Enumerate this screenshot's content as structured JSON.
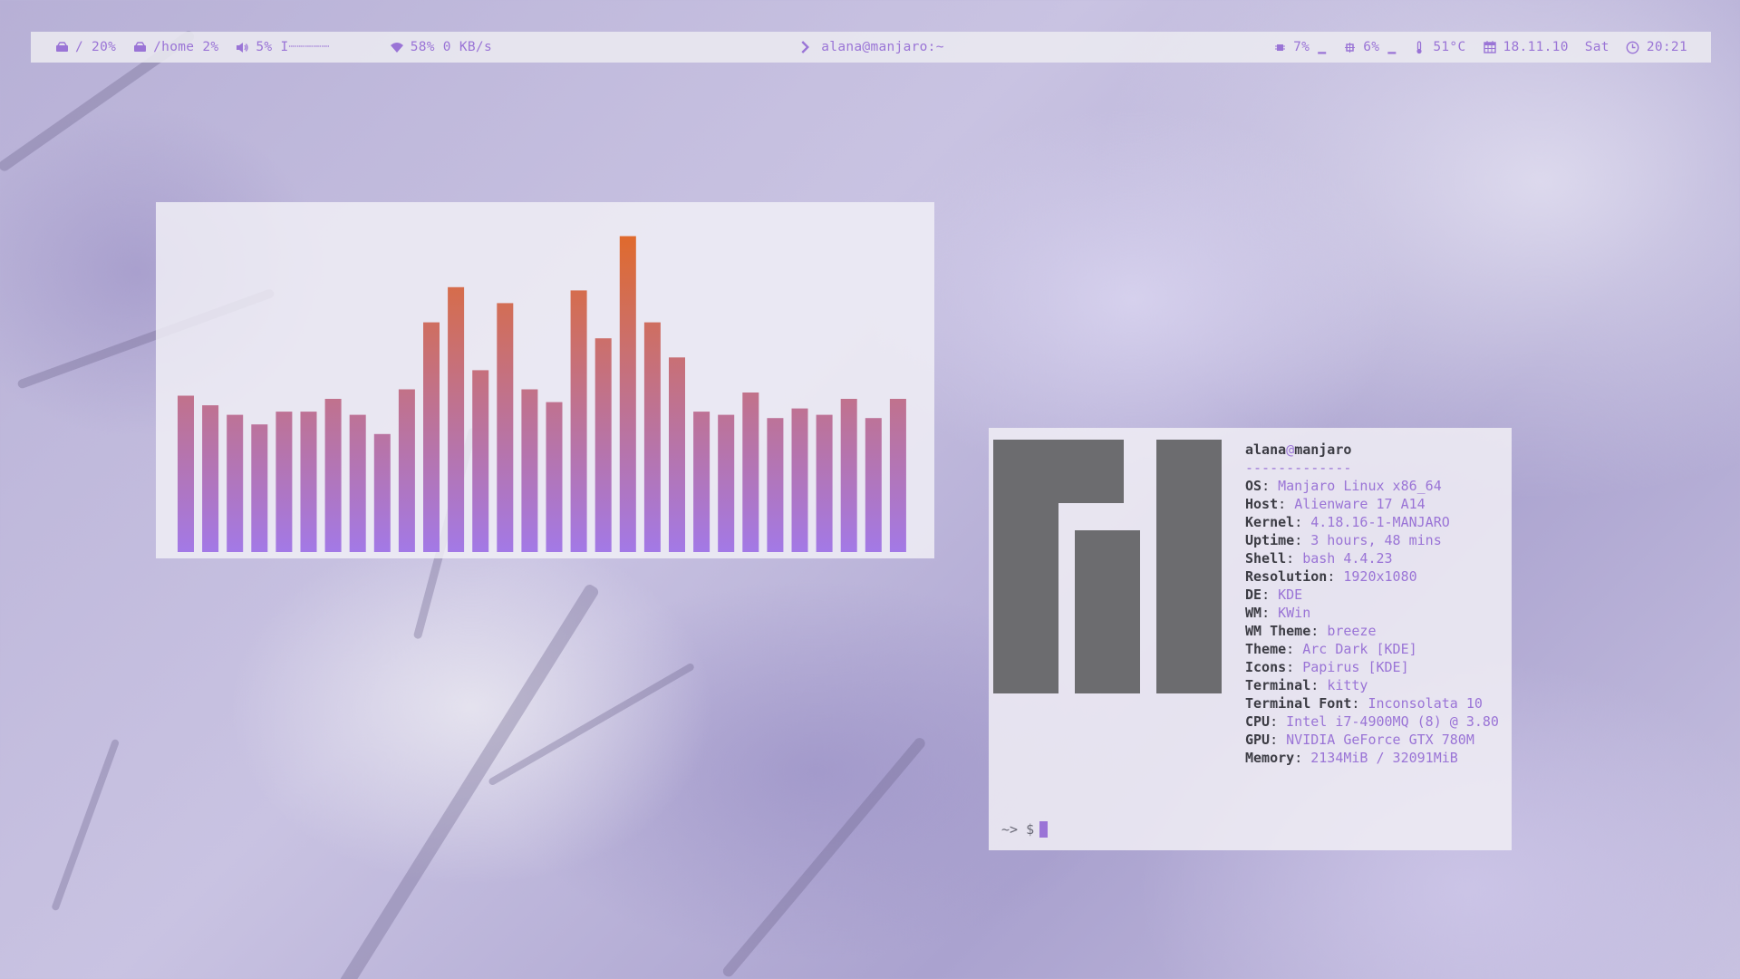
{
  "topbar": {
    "left": [
      {
        "icon": "drive-icon",
        "text": "/ 20%"
      },
      {
        "icon": "drive-icon",
        "text": "/home 2%"
      },
      {
        "icon": "volume-icon",
        "text": "5% I┈┈┈┈┈"
      },
      {
        "icon": "wifi-icon",
        "text": "58% 0 KB/s"
      }
    ],
    "center": {
      "icon": "chevron-right-icon",
      "text": "alana@manjaro:~"
    },
    "right": [
      {
        "icon": "cpu-icon",
        "text": "7% ▁"
      },
      {
        "icon": "memory-icon",
        "text": "6% ▁"
      },
      {
        "icon": "thermometer-icon",
        "text": "51°C"
      },
      {
        "icon": "calendar-icon",
        "text": "18.11.10"
      },
      {
        "icon": "",
        "text": "Sat"
      },
      {
        "icon": "clock-icon",
        "text": "20:21"
      }
    ]
  },
  "visualizer": {
    "levels": [
      0.49,
      0.46,
      0.43,
      0.4,
      0.44,
      0.44,
      0.48,
      0.43,
      0.37,
      0.51,
      0.72,
      0.83,
      0.57,
      0.78,
      0.51,
      0.47,
      0.82,
      0.67,
      0.99,
      0.72,
      0.61,
      0.44,
      0.43,
      0.5,
      0.42,
      0.45,
      0.43,
      0.48,
      0.42,
      0.48
    ],
    "color_top": "#e06a2c",
    "color_bottom": "#a379e6"
  },
  "terminal": {
    "user": "alana",
    "at": "@",
    "host": "manjaro",
    "separator": "-------------",
    "info": [
      {
        "key": "OS",
        "value": "Manjaro Linux x86_64"
      },
      {
        "key": "Host",
        "value": "Alienware 17 A14"
      },
      {
        "key": "Kernel",
        "value": "4.18.16-1-MANJARO"
      },
      {
        "key": "Uptime",
        "value": "3 hours, 48 mins"
      },
      {
        "key": "Shell",
        "value": "bash 4.4.23"
      },
      {
        "key": "Resolution",
        "value": "1920x1080"
      },
      {
        "key": "DE",
        "value": "KDE"
      },
      {
        "key": "WM",
        "value": "KWin"
      },
      {
        "key": "WM Theme",
        "value": "breeze"
      },
      {
        "key": "Theme",
        "value": "Arc Dark [KDE]"
      },
      {
        "key": "Icons",
        "value": "Papirus [KDE]"
      },
      {
        "key": "Terminal",
        "value": "kitty"
      },
      {
        "key": "Terminal Font",
        "value": "Inconsolata 10"
      },
      {
        "key": "CPU",
        "value": "Intel i7-4900MQ (8) @ 3.80"
      },
      {
        "key": "GPU",
        "value": "NVIDIA GeForce GTX 780M"
      },
      {
        "key": "Memory",
        "value": "2134MiB / 32091MiB"
      }
    ],
    "prompt": "~> $"
  },
  "colors": {
    "accent": "#9a74d6",
    "text_dark": "#3c3c44",
    "logo": "#6c6c6f"
  }
}
